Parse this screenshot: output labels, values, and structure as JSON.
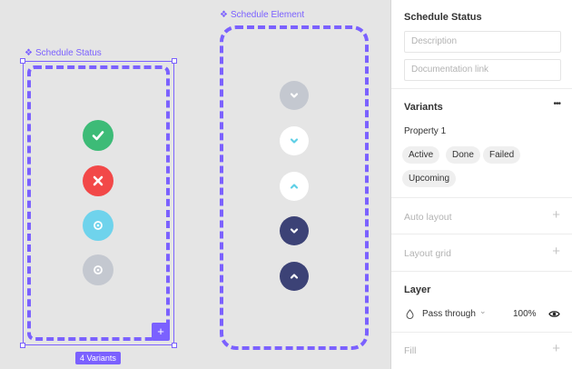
{
  "canvas": {
    "status_frame": {
      "label": "Schedule Status",
      "badge": "4 Variants",
      "add_glyph": "+"
    },
    "element_frame": {
      "label": "Schedule Element"
    },
    "status_icons": [
      {
        "icon": "check-icon",
        "color": "#3dbb77"
      },
      {
        "icon": "close-icon",
        "color": "#f24848"
      },
      {
        "icon": "dot-icon",
        "color": "#6fd3ec"
      },
      {
        "icon": "dot-icon",
        "color": "#c4c8d0"
      }
    ],
    "element_icons": [
      {
        "icon": "chevron-down-icon",
        "bg": "#c4c8d0",
        "fg": "#ffffff"
      },
      {
        "icon": "chevron-down-icon",
        "bg": "#ffffff",
        "fg": "#5ecfe6"
      },
      {
        "icon": "chevron-up-icon",
        "bg": "#ffffff",
        "fg": "#5ecfe6"
      },
      {
        "icon": "chevron-down-icon",
        "bg": "#3c4276",
        "fg": "#ffffff"
      },
      {
        "icon": "chevron-up-icon",
        "bg": "#3c4276",
        "fg": "#ffffff"
      }
    ],
    "accent": "#7b61ff"
  },
  "panel": {
    "title": "Schedule Status",
    "description_placeholder": "Description",
    "doc_link_placeholder": "Documentation link",
    "variants": {
      "title": "Variants",
      "more": "•••",
      "property_label": "Property 1",
      "values": [
        "Active",
        "Done",
        "Failed",
        "Upcoming"
      ]
    },
    "auto_layout": "Auto layout",
    "layout_grid": "Layout grid",
    "layer": {
      "title": "Layer",
      "blend_mode": "Pass through",
      "chevron": "⌄",
      "opacity": "100%"
    },
    "fill": "Fill",
    "plus_glyph": "+"
  }
}
